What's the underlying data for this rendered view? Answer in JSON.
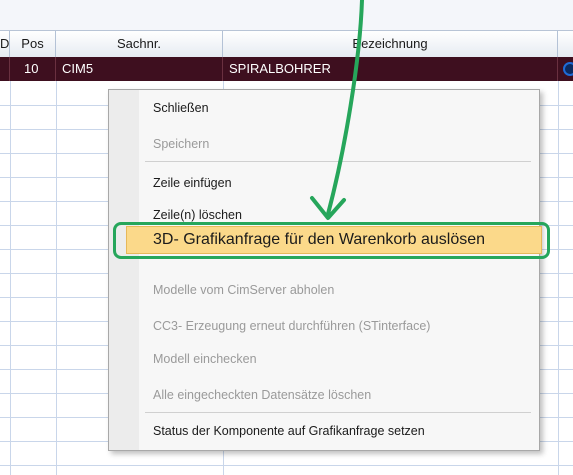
{
  "table": {
    "headers": {
      "col0": "D",
      "pos": "Pos",
      "sachnr": "Sachnr.",
      "bezeichnung": "Bezeichnung",
      "extra": ""
    },
    "row": {
      "pos": "10",
      "sachnr": "CIM5",
      "bezeichnung": "SPIRALBOHRER"
    }
  },
  "context_menu": {
    "items": [
      {
        "label": "Schließen",
        "enabled": true
      },
      {
        "label": "Speichern",
        "enabled": false
      },
      {
        "label": "Zeile einfügen",
        "enabled": true
      },
      {
        "label": "Zeile(n) löschen",
        "enabled": true
      },
      {
        "label": "3D- Grafikanfrage für den Warenkorb auslösen",
        "enabled": true,
        "highlighted": true
      },
      {
        "label": "Modelle vom CimServer abholen",
        "enabled": false
      },
      {
        "label": "CC3- Erzeugung erneut durchführen (STinterface)",
        "enabled": false
      },
      {
        "label": "Modell einchecken",
        "enabled": false
      },
      {
        "label": "Alle eingecheckten Datensätze löschen",
        "enabled": false
      },
      {
        "label": "Status der Komponente auf Grafikanfrage setzen",
        "enabled": true
      }
    ]
  },
  "annotation": {
    "color": "#26a65b",
    "highlight_color": "#fbd98a"
  },
  "colors": {
    "selected_row": "#3e0f1f",
    "grid_line": "#c9d6ea"
  }
}
